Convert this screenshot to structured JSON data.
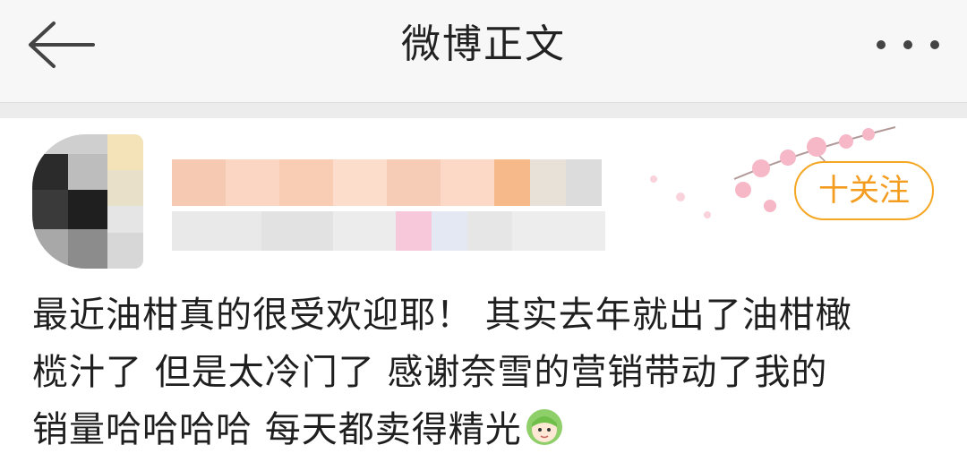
{
  "navbar": {
    "title": "微博正文",
    "back_icon": "arrow-left-icon",
    "more_icon": "more-dots-icon"
  },
  "post": {
    "follow_label": "十关注",
    "text_lines": [
      "最近油柑真的很受欢迎耶！  其实去年就出了油柑橄",
      "榄汁了 但是太冷门了 感谢奈雪的营销带动了我的",
      "销量哈哈哈哈 每天都卖得精光"
    ],
    "emoji_icon": "green-hair-girl-emoji-icon",
    "decoration_icon": "plum-blossom-branch-icon"
  },
  "colors": {
    "follow_accent": "#f39c1f",
    "topbar_bg": "#f7f7f7",
    "text": "#1f1f1f"
  }
}
